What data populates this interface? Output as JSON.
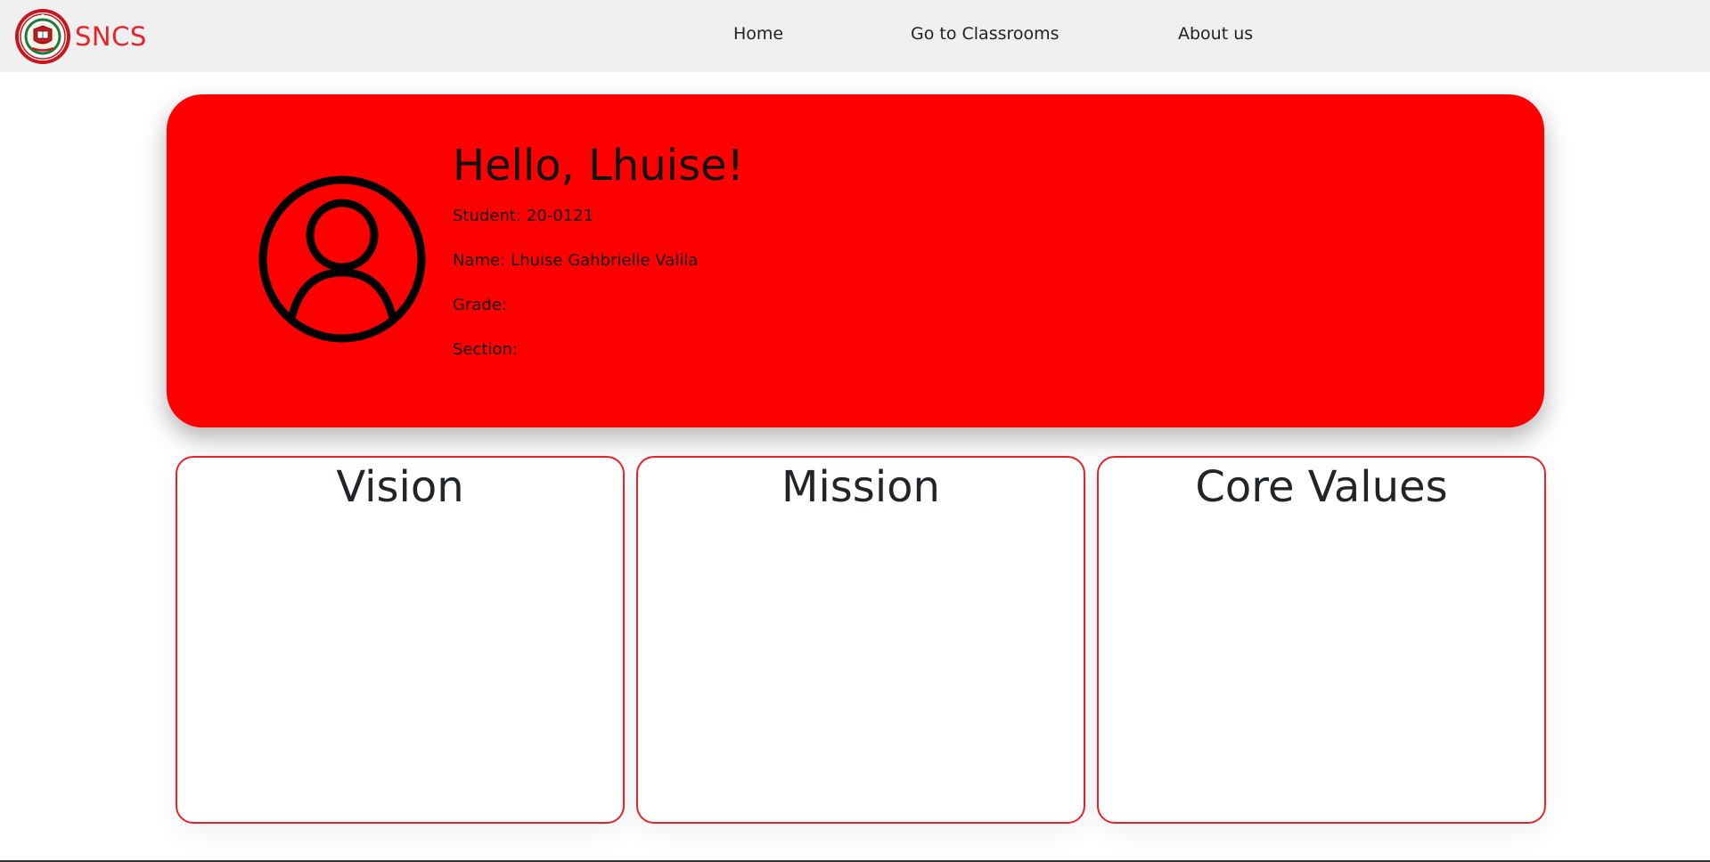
{
  "brand": {
    "name": "SNCS",
    "logo_icon": "school-seal-logo"
  },
  "nav": {
    "items": [
      {
        "label": "Home"
      },
      {
        "label": "Go to Classrooms"
      },
      {
        "label": "About us"
      }
    ]
  },
  "profile": {
    "greeting": "Hello, Lhuise!",
    "avatar_icon": "user-circle-icon",
    "student_label": "Student:",
    "student_value": "20-0121",
    "name_label": "Name:",
    "name_value": "Lhuise Gahbrielle Valila",
    "grade_label": "Grade:",
    "grade_value": "",
    "section_label": "Section:",
    "section_value": ""
  },
  "cards": [
    {
      "title": "Vision"
    },
    {
      "title": "Mission"
    },
    {
      "title": "Core Values"
    }
  ],
  "colors": {
    "accent_red": "#ff0000",
    "brand_red": "#e8232a",
    "navbar_bg": "#efefef"
  }
}
